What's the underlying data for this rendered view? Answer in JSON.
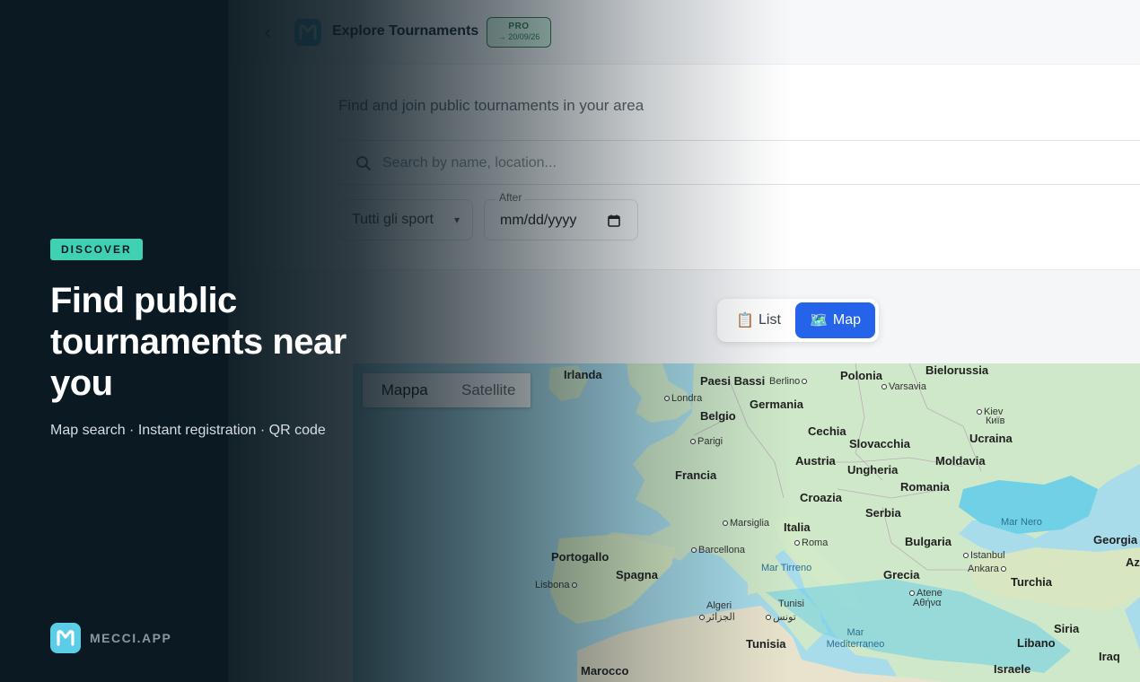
{
  "header": {
    "title": "Explore Tournaments",
    "pro_label": "PRO",
    "pro_expiry": "→ 20/09/26"
  },
  "filters": {
    "subtitle": "Find and join public tournaments in your area",
    "search_placeholder": "Search by name, location...",
    "sport_value": "Tutti gli sport",
    "date_label": "After",
    "date_value": "mm/dd/yyyy"
  },
  "view_toggle": {
    "list_label": "List",
    "map_label": "Map",
    "active": "Map"
  },
  "map": {
    "type_options": [
      "Mappa",
      "Satellite"
    ],
    "active_type": "Mappa",
    "countries": [
      "Irlanda",
      "Paesi Bassi",
      "Polonia",
      "Bielorussia",
      "Germania",
      "Belgio",
      "Cechia",
      "Ucraina",
      "Slovacchia",
      "Francia",
      "Austria",
      "Ungheria",
      "Moldavia",
      "Romania",
      "Croazia",
      "Serbia",
      "Italia",
      "Bulgaria",
      "Georgia",
      "Portogallo",
      "Spagna",
      "Grecia",
      "Turchia",
      "Tunisia",
      "Siria",
      "Libano",
      "Iraq",
      "Israele",
      "Marocco",
      "Az"
    ],
    "cities": [
      "Londra",
      "Berlino",
      "Varsavia",
      "Kiev",
      "Київ",
      "Parigi",
      "Marsiglia",
      "Barcellona",
      "Roma",
      "Istanbul",
      "Ankara",
      "Lisbona",
      "Atene",
      "Αθήνα",
      "Algeri",
      "الجزائر",
      "Tunisi",
      "تونس"
    ],
    "seas": [
      "Mar Nero",
      "Mar Tirreno",
      "Mar Mediterraneo"
    ]
  },
  "sidebar": {
    "badge": "DISCOVER",
    "headline": "Find public tournaments near you",
    "tagline": "Map search · Instant registration · QR code",
    "brand": "MECCI.APP"
  },
  "colors": {
    "background": "#0b1a22",
    "accent": "#3fd1b2",
    "primary": "#2563eb",
    "pro_green": "#2f7a55"
  }
}
